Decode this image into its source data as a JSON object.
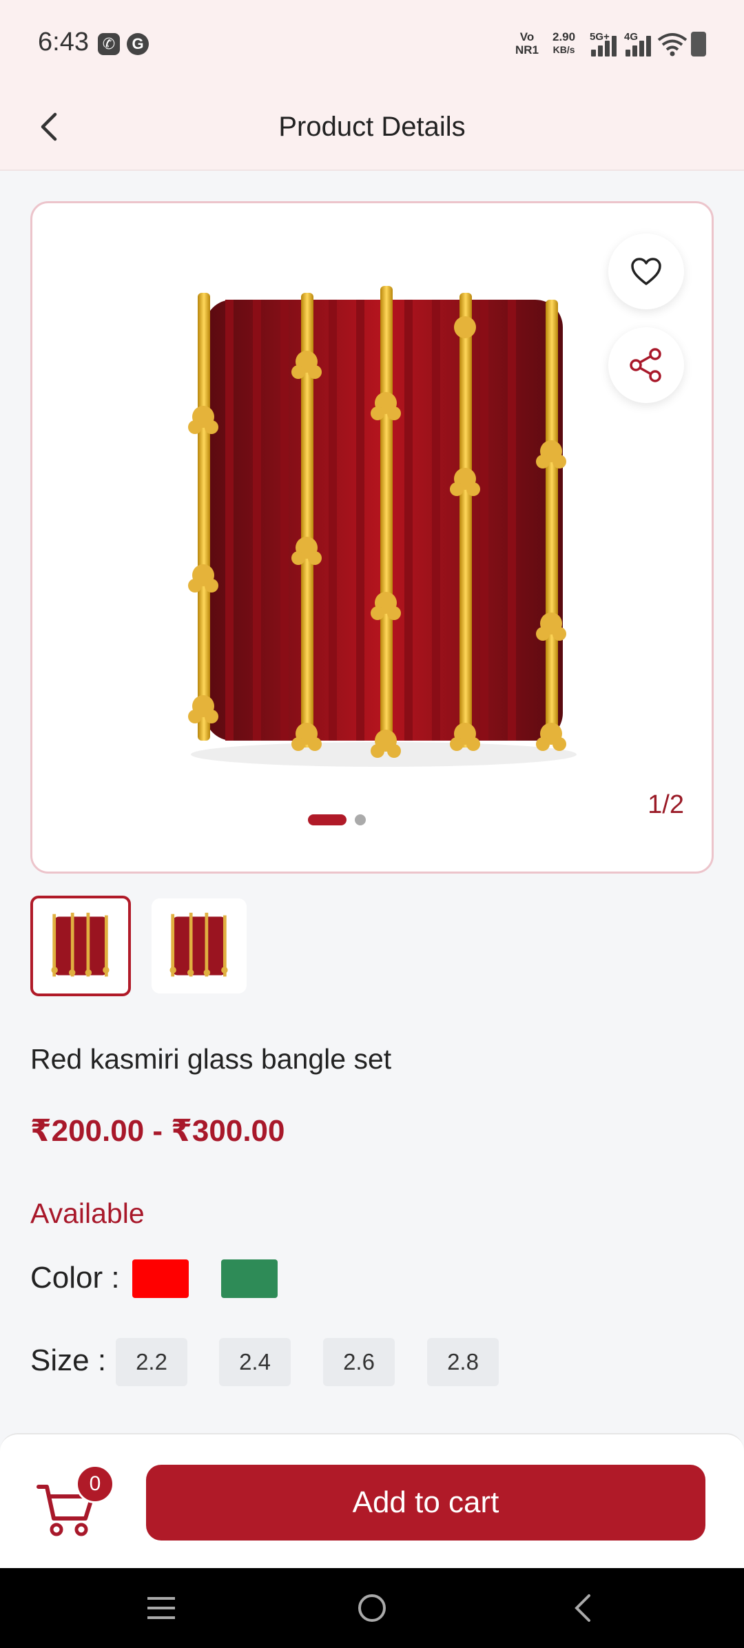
{
  "status_bar": {
    "time": "6:43",
    "app_icons": [
      "phone-icon",
      "google-icon"
    ],
    "vo_line1": "Vo",
    "vo_line2": "NR1",
    "speed_value": "2.90",
    "speed_unit": "KB/s",
    "net1": "5G+",
    "net2": "4G"
  },
  "header": {
    "title": "Product Details",
    "back_icon": "chevron-left-icon"
  },
  "gallery": {
    "counter": "1/2",
    "total_images": 2,
    "current_index": 1,
    "actions": [
      "heart-icon",
      "share-icon"
    ]
  },
  "product": {
    "name": "Red kasmiri glass bangle set",
    "price": "₹200.00 - ₹300.00",
    "availability": "Available",
    "color_label": "Color :",
    "colors": [
      "#ff0000",
      "#2e8b57"
    ],
    "size_label": "Size :",
    "sizes": [
      "2.2",
      "2.4",
      "2.6",
      "2.8"
    ]
  },
  "bottom": {
    "cart_count": "0",
    "add_to_cart": "Add to cart"
  },
  "accent_color": "#b01a28"
}
